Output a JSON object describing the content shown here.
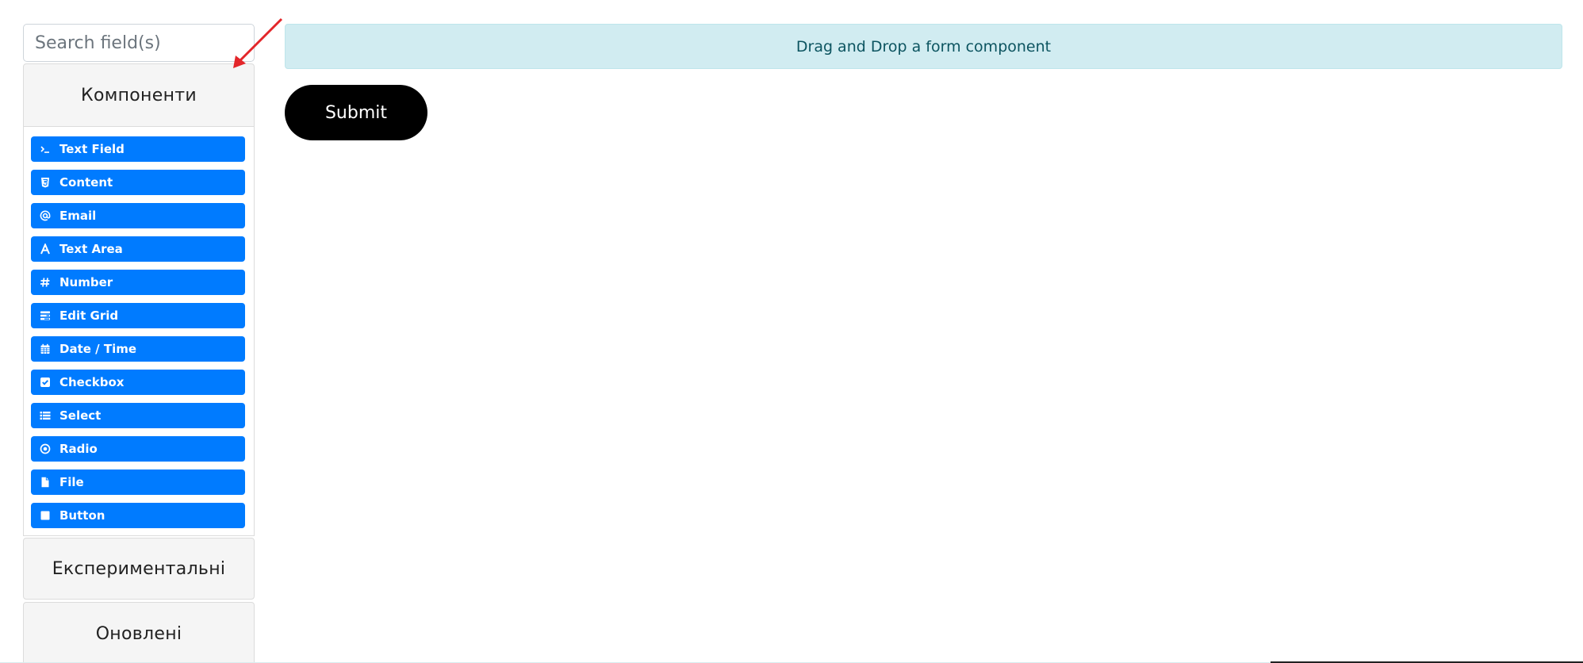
{
  "search": {
    "placeholder": "Search field(s)"
  },
  "groups": {
    "components": {
      "label": "Компоненти"
    },
    "experimental": {
      "label": "Експериментальні"
    },
    "updated": {
      "label": "Оновлені"
    }
  },
  "components": [
    {
      "label": "Text Field",
      "icon": "terminal-icon"
    },
    {
      "label": "Content",
      "icon": "html5-icon"
    },
    {
      "label": "Email",
      "icon": "at-icon"
    },
    {
      "label": "Text Area",
      "icon": "font-icon"
    },
    {
      "label": "Number",
      "icon": "hashtag-icon"
    },
    {
      "label": "Edit Grid",
      "icon": "tasks-icon"
    },
    {
      "label": "Date / Time",
      "icon": "calendar-icon"
    },
    {
      "label": "Checkbox",
      "icon": "check-square-icon"
    },
    {
      "label": "Select",
      "icon": "list-icon"
    },
    {
      "label": "Radio",
      "icon": "dot-circle-icon"
    },
    {
      "label": "File",
      "icon": "file-icon"
    },
    {
      "label": "Button",
      "icon": "stop-icon"
    }
  ],
  "dropzone": {
    "text": "Drag and Drop a form component"
  },
  "form": {
    "submit_label": "Submit"
  },
  "colors": {
    "component_button": "#007bff",
    "dropzone_bg": "#d1ecf1",
    "dropzone_text": "#0c5460",
    "submit_bg": "#000000",
    "annotation_arrow": "#e3262a"
  }
}
